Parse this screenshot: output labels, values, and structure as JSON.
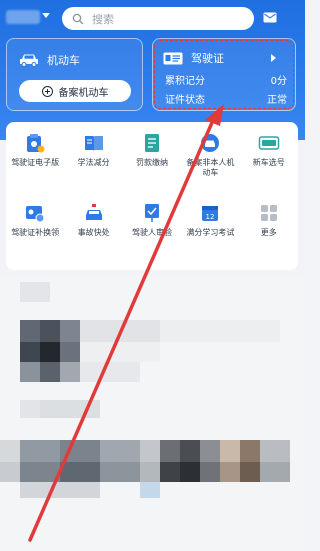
{
  "search": {
    "placeholder": "搜索"
  },
  "vehicle_card": {
    "title": "机动车",
    "button_label": "备案机动车"
  },
  "license_card": {
    "title": "驾驶证",
    "rows": [
      {
        "label": "累积记分",
        "value": "0分"
      },
      {
        "label": "证件状态",
        "value": "正常"
      }
    ]
  },
  "services": [
    {
      "label": "驾驶证电子版",
      "icon": "e-license-icon"
    },
    {
      "label": "学法减分",
      "icon": "book-icon"
    },
    {
      "label": "罚款缴纳",
      "icon": "fine-icon"
    },
    {
      "label": "备案非本人机动车",
      "icon": "car-register-icon"
    },
    {
      "label": "新车选号",
      "icon": "plate-icon"
    },
    {
      "label": "驾驶证补换领",
      "icon": "license-renew-icon"
    },
    {
      "label": "事故快处",
      "icon": "accident-icon"
    },
    {
      "label": "驾驶人审验",
      "icon": "driver-review-icon"
    },
    {
      "label": "满分学习考试",
      "icon": "calendar-icon"
    },
    {
      "label": "更多",
      "icon": "more-icon"
    }
  ],
  "colors": {
    "header_blue": "#2c7cec",
    "annotation_red": "#e03a3a",
    "icon_blue": "#2f7ae5",
    "icon_teal": "#2aa6a0"
  }
}
